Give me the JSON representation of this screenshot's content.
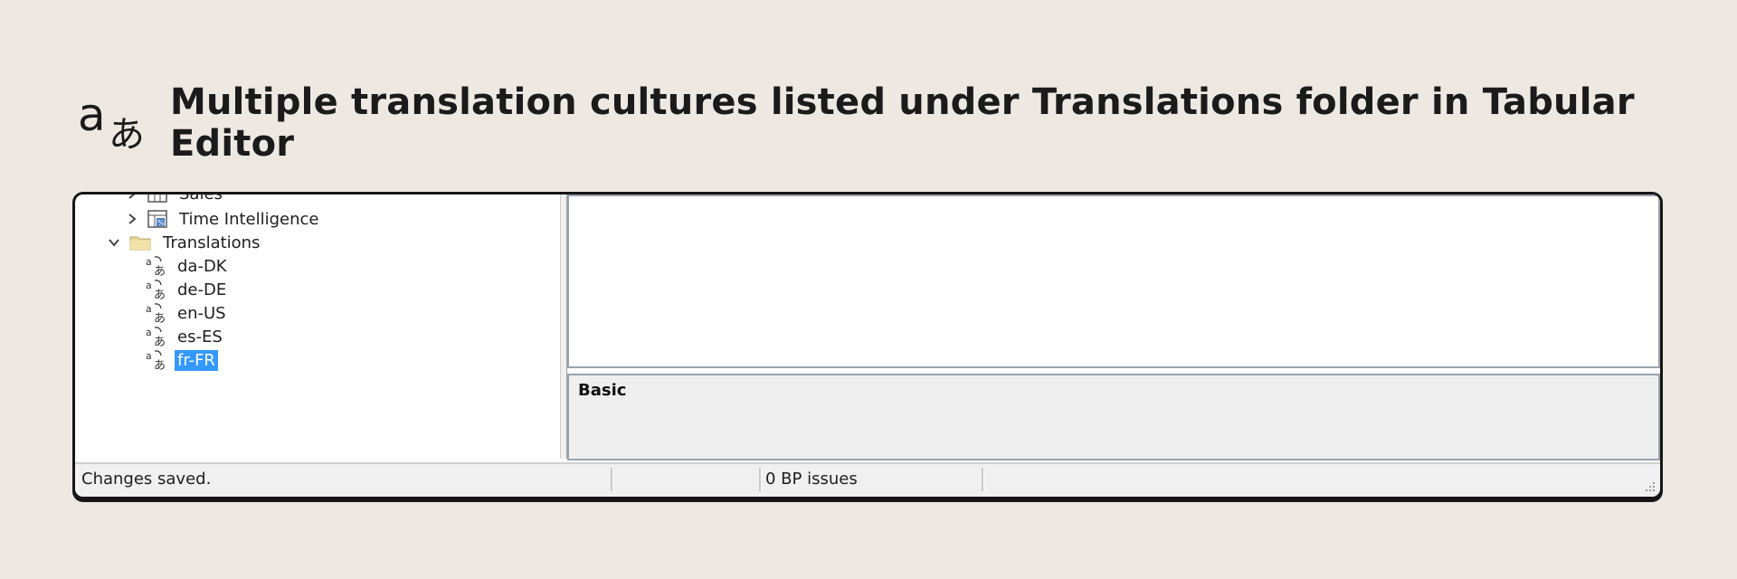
{
  "header": {
    "title": "Multiple translation cultures listed under Translations folder in Tabular Editor",
    "icon": "translate-icon"
  },
  "tree": {
    "partial_item": "Sales",
    "items": [
      {
        "label": "Time Intelligence",
        "icon": "calculation-table-icon"
      },
      {
        "label": "Translations",
        "icon": "folder-icon"
      },
      {
        "label": "da-DK",
        "icon": "culture-icon"
      },
      {
        "label": "de-DE",
        "icon": "culture-icon"
      },
      {
        "label": "en-US",
        "icon": "culture-icon"
      },
      {
        "label": "es-ES",
        "icon": "culture-icon"
      },
      {
        "label": "fr-FR",
        "icon": "culture-icon",
        "selected": true
      }
    ]
  },
  "properties": {
    "category_label": "Basic"
  },
  "statusbar": {
    "message": "Changes saved.",
    "segment2": "",
    "bp_issues": "0 BP issues",
    "segment4": ""
  },
  "colors": {
    "background": "#ede9e2",
    "selection": "#3399ff",
    "window_border": "#161616"
  }
}
